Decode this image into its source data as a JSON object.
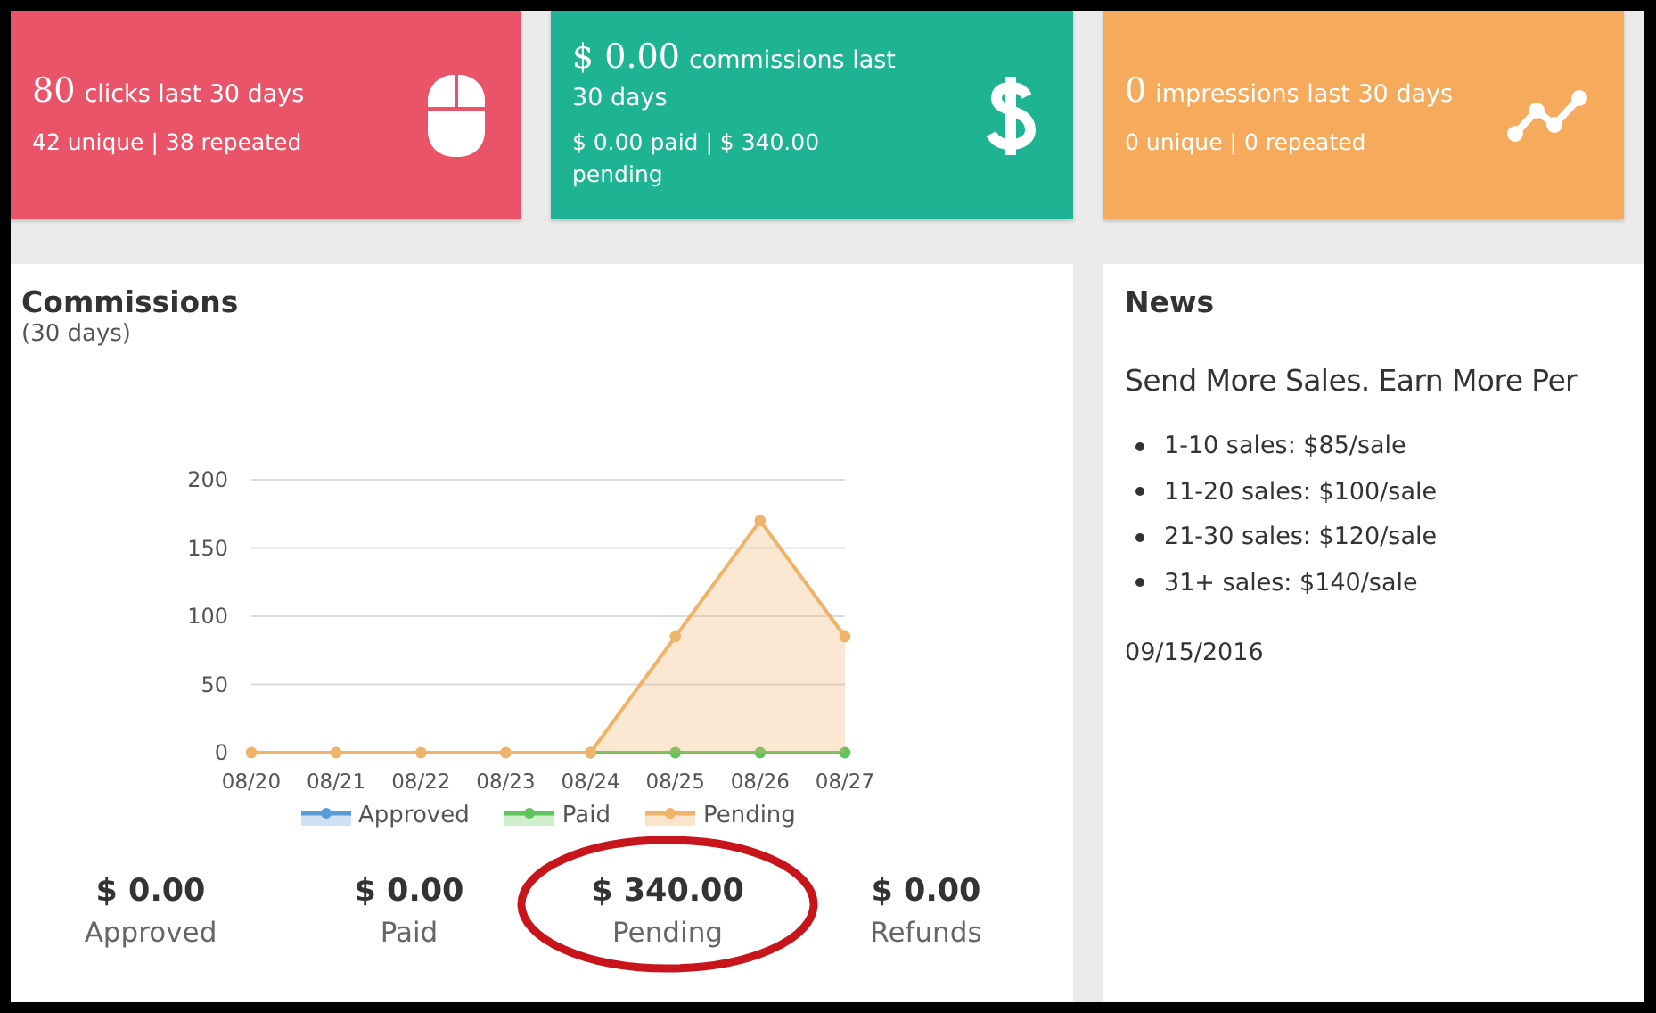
{
  "stat_cards": [
    {
      "kind": "clicks",
      "color": "#ea5468",
      "value": "80",
      "label": "clicks last 30 days",
      "detail": "42 unique | 38 repeated"
    },
    {
      "kind": "commissions",
      "color": "#1db393",
      "value": "$ 0.00",
      "label": "commissions last 30 days",
      "detail": "$ 0.00 paid | $ 340.00 pending"
    },
    {
      "kind": "impressions",
      "color": "#f6ab5c",
      "value": "0",
      "label": "impressions last 30 days",
      "detail": "0 unique | 0 repeated"
    }
  ],
  "commissions": {
    "title": "Commissions",
    "subtitle": "(30 days)",
    "chart_data": {
      "type": "line",
      "grid": true,
      "legend": "bottom",
      "categories": [
        "08/20",
        "08/21",
        "08/22",
        "08/23",
        "08/24",
        "08/25",
        "08/26",
        "08/27"
      ],
      "ylim": [
        0,
        200
      ],
      "yticks": [
        0,
        50,
        100,
        150,
        200
      ],
      "series": [
        {
          "name": "Approved",
          "color": "#5b9bd5",
          "type": "line",
          "marker": "circle",
          "values": [
            null,
            null,
            null,
            null,
            null,
            null,
            null,
            null
          ]
        },
        {
          "name": "Paid",
          "color": "#5cc65c",
          "type": "line",
          "marker": "circle",
          "values": [
            null,
            null,
            null,
            null,
            0,
            0,
            0,
            0
          ]
        },
        {
          "name": "Pending",
          "color": "#f0b36a",
          "type": "area",
          "marker": "circle",
          "values": [
            0,
            0,
            0,
            0,
            0,
            85,
            170,
            85
          ]
        }
      ]
    },
    "summaries": [
      {
        "amount": "$ 0.00",
        "label": "Approved",
        "circled": false
      },
      {
        "amount": "$ 0.00",
        "label": "Paid",
        "circled": false
      },
      {
        "amount": "$ 340.00",
        "label": "Pending",
        "circled": true
      },
      {
        "amount": "$ 0.00",
        "label": "Refunds",
        "circled": false
      }
    ]
  },
  "news": {
    "title": "News",
    "headline": "Send More Sales. Earn More Per",
    "items": [
      "1-10 sales: $85/sale",
      "11-20 sales: $100/sale",
      "21-30 sales: $120/sale",
      "31+ sales: $140/sale"
    ],
    "date": "09/15/2016"
  }
}
